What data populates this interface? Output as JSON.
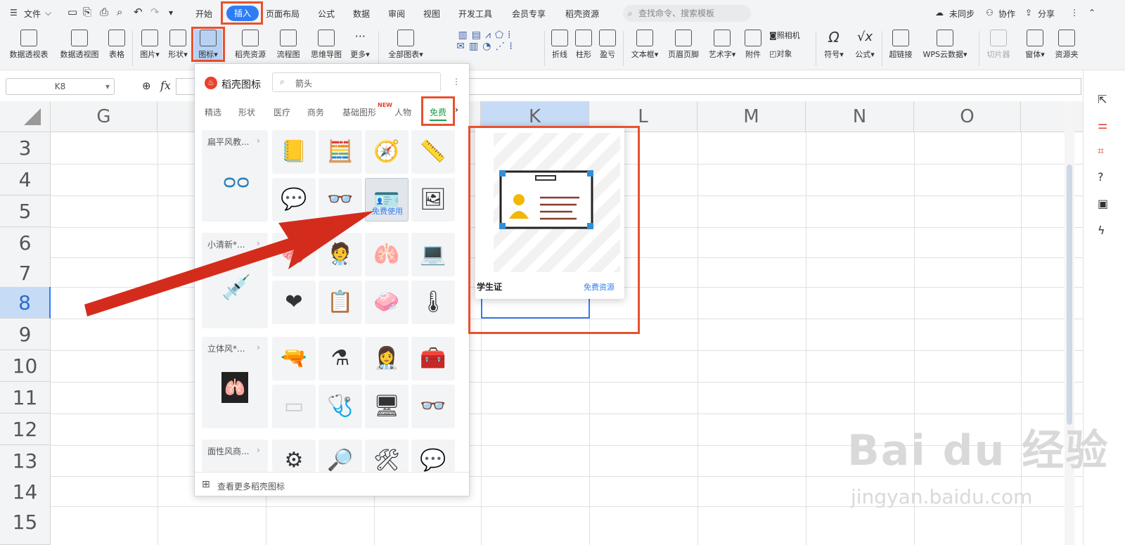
{
  "menubar": {
    "file": "文件",
    "tabs": [
      "开始",
      "插入",
      "页面布局",
      "公式",
      "数据",
      "审阅",
      "视图",
      "开发工具",
      "会员专享",
      "稻壳资源"
    ],
    "search_placeholder": "查找命令、搜索模板",
    "sync": "未同步",
    "collab": "协作",
    "share": "分享"
  },
  "ribbon": {
    "items": [
      "数据透视表",
      "数据透视图",
      "表格",
      "图片",
      "形状",
      "图标",
      "稻壳资源",
      "流程图",
      "思维导图",
      "更多",
      "全部图表",
      "折线",
      "柱形",
      "盈亏",
      "文本框",
      "页眉页脚",
      "艺术字",
      "附件",
      "照相机",
      "对象",
      "符号",
      "公式",
      "超链接",
      "WPS云数据",
      "切片器",
      "窗体",
      "资源夹"
    ]
  },
  "formula": {
    "namebox": "K8",
    "fx": "fx"
  },
  "grid": {
    "columns": [
      "G",
      "H",
      "I",
      "J",
      "K",
      "L",
      "M",
      "N",
      "O"
    ],
    "rows": [
      "3",
      "4",
      "5",
      "6",
      "7",
      "8",
      "9",
      "10",
      "11",
      "12",
      "13",
      "14",
      "15"
    ]
  },
  "panel": {
    "title": "稻壳图标",
    "search_value": "箭头",
    "tabs": [
      "精选",
      "形状",
      "医疗",
      "商务",
      "基础图形",
      "人物",
      "免费"
    ],
    "new_badge": "NEW",
    "categories": [
      "扁平风教...",
      "小清新*...",
      "立体风*...",
      "面性风商..."
    ],
    "hover_label": "免费使用",
    "footer": "查看更多稻壳图标"
  },
  "preview": {
    "name": "学生证",
    "tag": "免费资源"
  },
  "watermark": {
    "brand": "Bai du 经验",
    "url": "jingyan.baidu.com"
  },
  "colors": {
    "accent": "#2f7df6",
    "highlight": "#e8512f",
    "arrow": "#d42c1c"
  }
}
